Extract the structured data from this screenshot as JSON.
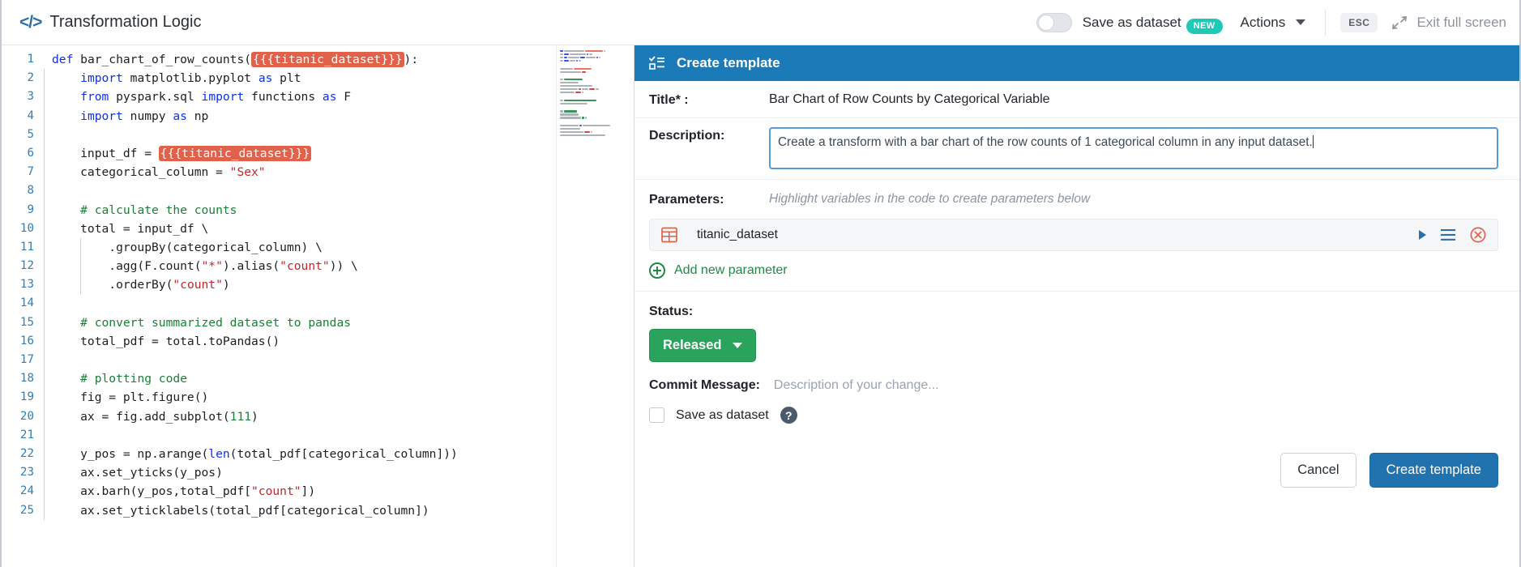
{
  "header": {
    "code_icon": "code-brackets-icon",
    "title": "Transformation Logic",
    "toggle_label": "Save as dataset",
    "new_badge": "NEW",
    "actions_label": "Actions",
    "esc_key": "ESC",
    "exit_label": "Exit full screen"
  },
  "editor": {
    "lines": [
      {
        "n": "1",
        "tokens": [
          {
            "t": "def ",
            "c": "k"
          },
          {
            "t": "bar_chart_of_row_counts(",
            "c": "ctxt"
          },
          {
            "t": "{{{titanic_dataset}}}",
            "c": "param-chip"
          },
          {
            "t": "):",
            "c": "ctxt"
          }
        ]
      },
      {
        "n": "2",
        "indent": true,
        "tokens": [
          {
            "t": "    ",
            "c": "ctxt"
          },
          {
            "t": "import",
            "c": "k"
          },
          {
            "t": " matplotlib.pyplot ",
            "c": "ctxt"
          },
          {
            "t": "as",
            "c": "k"
          },
          {
            "t": " plt",
            "c": "ctxt"
          }
        ]
      },
      {
        "n": "3",
        "indent": true,
        "tokens": [
          {
            "t": "    ",
            "c": "ctxt"
          },
          {
            "t": "from",
            "c": "k"
          },
          {
            "t": " pyspark.sql ",
            "c": "ctxt"
          },
          {
            "t": "import",
            "c": "k"
          },
          {
            "t": " functions ",
            "c": "ctxt"
          },
          {
            "t": "as",
            "c": "k"
          },
          {
            "t": " F",
            "c": "ctxt"
          }
        ]
      },
      {
        "n": "4",
        "indent": true,
        "tokens": [
          {
            "t": "    ",
            "c": "ctxt"
          },
          {
            "t": "import",
            "c": "k"
          },
          {
            "t": " numpy ",
            "c": "ctxt"
          },
          {
            "t": "as",
            "c": "k"
          },
          {
            "t": " np",
            "c": "ctxt"
          }
        ]
      },
      {
        "n": "5",
        "indent": true,
        "tokens": []
      },
      {
        "n": "6",
        "indent": true,
        "tokens": [
          {
            "t": "    input_df = ",
            "c": "ctxt"
          },
          {
            "t": "{{{titanic_dataset}}}",
            "c": "param-chip"
          }
        ]
      },
      {
        "n": "7",
        "indent": true,
        "tokens": [
          {
            "t": "    categorical_column = ",
            "c": "ctxt"
          },
          {
            "t": "\"Sex\"",
            "c": "s"
          }
        ]
      },
      {
        "n": "8",
        "indent": true,
        "tokens": []
      },
      {
        "n": "9",
        "indent": true,
        "tokens": [
          {
            "t": "    ",
            "c": "ctxt"
          },
          {
            "t": "# calculate the counts",
            "c": "c"
          }
        ]
      },
      {
        "n": "10",
        "indent": true,
        "tokens": [
          {
            "t": "    total = input_df \\",
            "c": "ctxt"
          }
        ]
      },
      {
        "n": "11",
        "indent": true,
        "indent2": true,
        "tokens": [
          {
            "t": "        .groupBy(categorical_column) \\",
            "c": "ctxt"
          }
        ]
      },
      {
        "n": "12",
        "indent": true,
        "indent2": true,
        "tokens": [
          {
            "t": "        .agg(F.count(",
            "c": "ctxt"
          },
          {
            "t": "\"*\"",
            "c": "s"
          },
          {
            "t": ").alias(",
            "c": "ctxt"
          },
          {
            "t": "\"count\"",
            "c": "s"
          },
          {
            "t": ")) \\",
            "c": "ctxt"
          }
        ]
      },
      {
        "n": "13",
        "indent": true,
        "indent2": true,
        "tokens": [
          {
            "t": "        .orderBy(",
            "c": "ctxt"
          },
          {
            "t": "\"count\"",
            "c": "s"
          },
          {
            "t": ")",
            "c": "ctxt"
          }
        ]
      },
      {
        "n": "14",
        "indent": true,
        "tokens": []
      },
      {
        "n": "15",
        "indent": true,
        "tokens": [
          {
            "t": "    ",
            "c": "ctxt"
          },
          {
            "t": "# convert summarized dataset to pandas",
            "c": "c"
          }
        ]
      },
      {
        "n": "16",
        "indent": true,
        "tokens": [
          {
            "t": "    total_pdf = total.toPandas()",
            "c": "ctxt"
          }
        ]
      },
      {
        "n": "17",
        "indent": true,
        "tokens": []
      },
      {
        "n": "18",
        "indent": true,
        "tokens": [
          {
            "t": "    ",
            "c": "ctxt"
          },
          {
            "t": "# plotting code",
            "c": "c"
          }
        ]
      },
      {
        "n": "19",
        "indent": true,
        "tokens": [
          {
            "t": "    fig = plt.figure()",
            "c": "ctxt"
          }
        ]
      },
      {
        "n": "20",
        "indent": true,
        "tokens": [
          {
            "t": "    ax = fig.add_subplot(",
            "c": "ctxt"
          },
          {
            "t": "111",
            "c": "n"
          },
          {
            "t": ")",
            "c": "ctxt"
          }
        ]
      },
      {
        "n": "21",
        "indent": true,
        "tokens": []
      },
      {
        "n": "22",
        "indent": true,
        "tokens": [
          {
            "t": "    y_pos = np.arange(",
            "c": "ctxt"
          },
          {
            "t": "len",
            "c": "f"
          },
          {
            "t": "(total_pdf[categorical_column]))",
            "c": "ctxt"
          }
        ]
      },
      {
        "n": "23",
        "indent": true,
        "tokens": [
          {
            "t": "    ax.set_yticks(y_pos)",
            "c": "ctxt"
          }
        ]
      },
      {
        "n": "24",
        "indent": true,
        "tokens": [
          {
            "t": "    ax.barh(y_pos,total_pdf[",
            "c": "ctxt"
          },
          {
            "t": "\"count\"",
            "c": "s"
          },
          {
            "t": "])",
            "c": "ctxt"
          }
        ]
      },
      {
        "n": "25",
        "indent": true,
        "tokens": [
          {
            "t": "    ax.set_yticklabels(total_pdf[categorical_column])",
            "c": "ctxt"
          }
        ]
      }
    ]
  },
  "panel": {
    "icon": "template-list-icon",
    "title": "Create template",
    "title_label": "Title* :",
    "title_value": "Bar Chart of Row Counts by Categorical Variable",
    "description_label": "Description:",
    "description_value": "Create a transform with a bar chart of the row counts of 1 categorical column in any input dataset.",
    "parameters_label": "Parameters:",
    "parameters_hint": "Highlight variables in the code to create parameters below",
    "parameters": [
      {
        "icon": "table-icon",
        "name": "titanic_dataset",
        "expand_icon": "triangle-right-icon",
        "reorder_icon": "list-lines-icon",
        "delete_icon": "delete-circle-icon"
      }
    ],
    "add_parameter_label": "Add new parameter",
    "status_label": "Status:",
    "status_value": "Released",
    "commit_label": "Commit Message:",
    "commit_placeholder": "Description of your change...",
    "save_dataset_label": "Save as dataset",
    "help_glyph": "?",
    "cancel_label": "Cancel",
    "create_label": "Create template"
  },
  "colors": {
    "panel_header": "#1b7ab8",
    "status_green": "#2aa35c",
    "primary_blue": "#2173b0",
    "param_chip": "#e2614a",
    "new_badge": "#1ec9b7"
  }
}
